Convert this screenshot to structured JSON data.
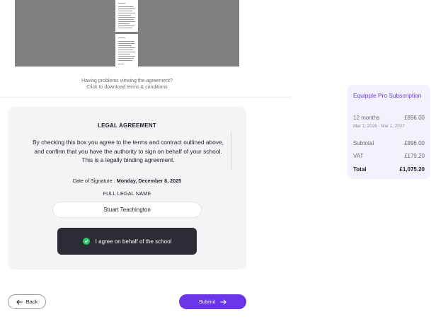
{
  "viewer": {
    "help_line1": "Having problems viewing the agreement?",
    "help_line2": "Click to download terms & conditions"
  },
  "legal": {
    "title": "LEGAL AGREEMENT",
    "agreement_text": "By checking this box you agree to the terms and contract outlined above, and confirm that you have the authority to sign on behalf of your school. This is a legally binding agreement.",
    "date_label": "Date of Signature :",
    "date_value": "Monday, December 8, 2025",
    "name_label": "FULL LEGAL NAME",
    "name_value": "Stuart Teachington",
    "agree_label": "I agree on behalf of the school"
  },
  "footer": {
    "back_label": "Back",
    "submit_label": "Submit"
  },
  "summary": {
    "title": "Equipple Pro Subscription",
    "term_label": "12 months",
    "term_price": "£896.00",
    "term_dates": "Mar 1, 2026 - Mar 1, 2027",
    "subtotal_label": "Subtotal",
    "subtotal_value": "£896.00",
    "vat_label": "VAT",
    "vat_value": "£179.20",
    "total_label": "Total",
    "total_value": "£1,075.20"
  },
  "colors": {
    "accent": "#6a35e8",
    "accent_text": "#6a3ad8",
    "dark_button": "#2c2c34",
    "success": "#2ec36b",
    "summary_bg": "#f2f1fd"
  }
}
